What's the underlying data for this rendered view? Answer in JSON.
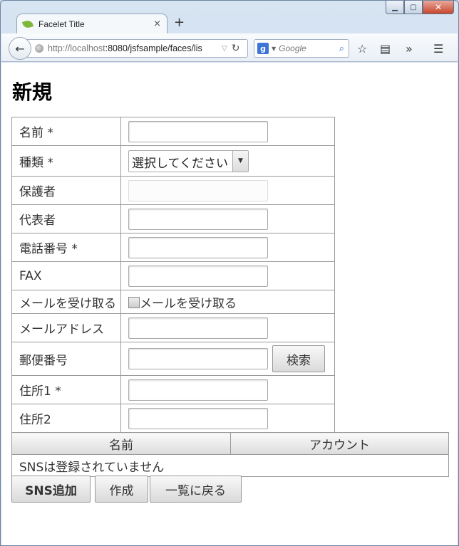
{
  "browser": {
    "tab_title": "Facelet Title",
    "tab_close": "×",
    "new_tab": "+",
    "url_host": "http://localhost",
    "url_rest": ":8080/jsfsample/faces/lis",
    "search_engine": "g",
    "search_placeholder": "Google"
  },
  "page": {
    "title": "新規",
    "form_rows": [
      {
        "label": "名前 *"
      },
      {
        "label": "種類 *",
        "select_value": "選択してください"
      },
      {
        "label": "保護者"
      },
      {
        "label": "代表者"
      },
      {
        "label": "電話番号 *"
      },
      {
        "label": "FAX"
      },
      {
        "label": "メールを受け取る",
        "checkbox_label": "メールを受け取る"
      },
      {
        "label": "メールアドレス"
      },
      {
        "label": "郵便番号",
        "button": "検索"
      },
      {
        "label": "住所1 *"
      },
      {
        "label": "住所2"
      }
    ],
    "sns_table": {
      "headers": [
        "名前",
        "アカウント"
      ],
      "empty_message": "SNSは登録されていません"
    },
    "actions": {
      "add_sns": "SNS追加",
      "create": "作成",
      "back_to_list": "一覧に戻る"
    }
  }
}
